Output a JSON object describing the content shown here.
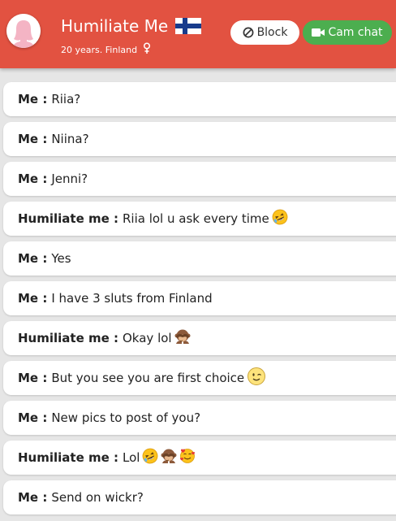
{
  "header": {
    "name": "Humiliate Me",
    "subtitle": "20 years. Finland",
    "block_label": "Block",
    "cam_label": "Cam chat",
    "icons": [
      "avatar-placeholder-icon",
      "finland-flag-icon",
      "female-symbol-icon",
      "block-icon",
      "video-camera-icon"
    ],
    "colors": {
      "header": "#e25241",
      "cam_button": "#4cae4f",
      "background": "#e6e6e6"
    }
  },
  "messages": [
    {
      "sender": "Me :",
      "text": "Riia?",
      "emojis": []
    },
    {
      "sender": "Me :",
      "text": "Niina?",
      "emojis": []
    },
    {
      "sender": "Me :",
      "text": "Jenni?",
      "emojis": []
    },
    {
      "sender": "Humiliate me :",
      "text": "Riia lol u ask every time",
      "emojis": [
        "rofl"
      ]
    },
    {
      "sender": "Me :",
      "text": "Yes",
      "emojis": []
    },
    {
      "sender": "Me :",
      "text": "I have 3 sluts from Finland",
      "emojis": []
    },
    {
      "sender": "Humiliate me :",
      "text": "Okay lol",
      "emojis": [
        "see-no-evil-monkey"
      ]
    },
    {
      "sender": "Me :",
      "text": "But you see you are first choice",
      "emojis": [
        "wink"
      ]
    },
    {
      "sender": "Me :",
      "text": "New pics to post of you?",
      "emojis": []
    },
    {
      "sender": "Humiliate me :",
      "text": "Lol",
      "emojis": [
        "rofl",
        "see-no-evil-monkey",
        "smiling-face-with-hearts"
      ]
    },
    {
      "sender": "Me :",
      "text": "Send on wickr?",
      "emojis": []
    }
  ]
}
